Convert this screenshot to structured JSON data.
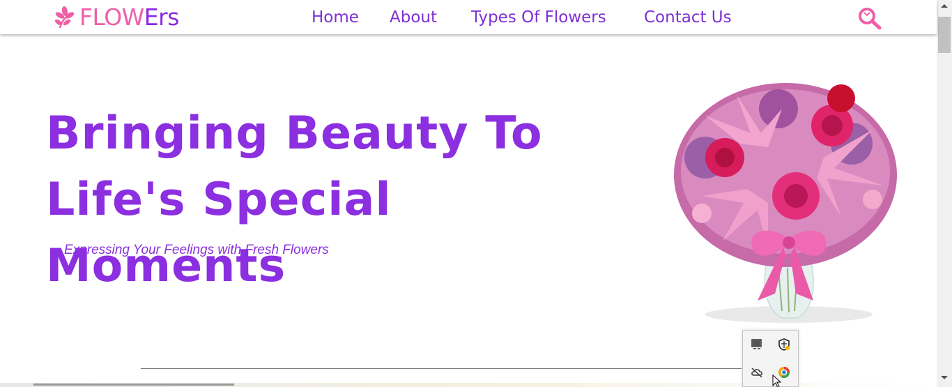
{
  "logo": {
    "icon": "flower-icon",
    "text_part1": "FLOW",
    "text_part2": "Ers",
    "color_part1": "#ef5fa7",
    "color_part2": "#8a2be2"
  },
  "nav": {
    "items": [
      {
        "label": "Home"
      },
      {
        "label": "About"
      },
      {
        "label": "Types Of Flowers"
      },
      {
        "label": "Contact Us"
      }
    ],
    "search_icon": "search-icon"
  },
  "hero": {
    "title_line1": "Bringing Beauty To",
    "title_line2": "Life's Special Moments",
    "subtitle": "Expressing Your Feelings with Fresh Flowers",
    "image": "flower-bouquet-vase",
    "accent_color": "#8b2fe0"
  },
  "tray": {
    "icons": [
      "display-icon",
      "security-shield-icon",
      "onedrive-offline-icon",
      "browser-icon"
    ]
  }
}
